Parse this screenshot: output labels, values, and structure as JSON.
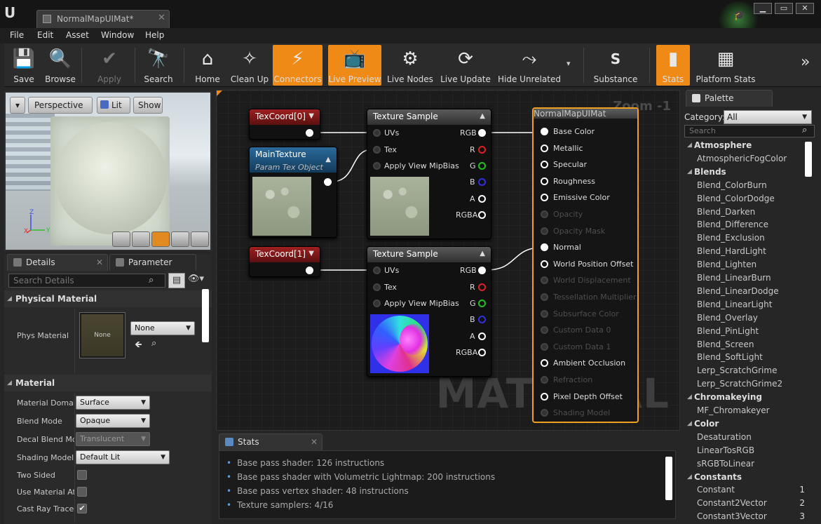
{
  "window": {
    "tab_title": "NormalMapUIMat*",
    "close_glyph": "✕",
    "buttons": [
      "▁",
      "▭",
      "✕"
    ]
  },
  "menu": [
    "File",
    "Edit",
    "Asset",
    "Window",
    "Help"
  ],
  "toolbar": {
    "items": [
      {
        "label": "Save",
        "icon": "save-icon",
        "glyph": "💾"
      },
      {
        "label": "Browse",
        "icon": "magnifier-icon",
        "glyph": "🔍"
      },
      {
        "label": "Apply",
        "icon": "apply-check-icon",
        "glyph": "✔"
      },
      {
        "label": "Search",
        "icon": "binoculars-icon",
        "glyph": "🔭"
      },
      {
        "label": "Home",
        "icon": "home-icon",
        "glyph": "⌂"
      },
      {
        "label": "Clean Up",
        "icon": "broom-icon",
        "glyph": "✧"
      },
      {
        "label": "Connectors",
        "icon": "connectors-icon",
        "glyph": "⚡"
      },
      {
        "label": "Live Preview",
        "icon": "tv-icon",
        "glyph": "📺"
      },
      {
        "label": "Live Nodes",
        "icon": "live-nodes-icon",
        "glyph": "⚙"
      },
      {
        "label": "Live Update",
        "icon": "live-update-icon",
        "glyph": "⟳"
      },
      {
        "label": "Hide Unrelated",
        "icon": "hide-unrelated-icon",
        "glyph": "⤳"
      },
      {
        "label": "Substance",
        "icon": "substance-icon",
        "glyph": "S"
      },
      {
        "label": "Stats",
        "icon": "stats-icon",
        "glyph": "▮"
      },
      {
        "label": "Platform Stats",
        "icon": "platform-stats-icon",
        "glyph": "▦"
      }
    ],
    "overflow_glyph": "»",
    "dropdown_glyph": "▾"
  },
  "viewport": {
    "view_dropdown": "▾",
    "perspective": "Perspective",
    "lit": "Lit",
    "show": "Show",
    "axis": {
      "z": "Z",
      "x": "X",
      "y": "Y"
    }
  },
  "details": {
    "tab_label": "Details",
    "tab2_label": "Parameter Defaul",
    "search_placeholder": "Search Details",
    "sections": {
      "physical": "Physical Material",
      "material": "Material"
    },
    "phys_material": {
      "label": "Phys Material",
      "thumb": "None",
      "value": "None"
    },
    "props": [
      {
        "label": "Material Domain",
        "value": "Surface"
      },
      {
        "label": "Blend Mode",
        "value": "Opaque"
      },
      {
        "label": "Decal Blend Mode",
        "value": "Translucent"
      },
      {
        "label": "Shading Model",
        "value": "Default Lit"
      },
      {
        "label": "Two Sided",
        "value": ""
      },
      {
        "label": "Use Material Attributes",
        "value": ""
      },
      {
        "label": "Cast Ray Traced Shadows",
        "value": "✔"
      }
    ]
  },
  "graph": {
    "zoom": "Zoom -1",
    "watermark": "MATERIAL",
    "nodes": {
      "texcoord0": {
        "title": "TexCoord[0]"
      },
      "texcoord1": {
        "title": "TexCoord[1]"
      },
      "maintexture": {
        "title": "MainTexture",
        "subtitle": "Param Tex Object"
      },
      "texsample1": {
        "title": "Texture Sample"
      },
      "texsample2": {
        "title": "Texture Sample"
      }
    },
    "tex_inputs": [
      "UVs",
      "Tex",
      "Apply View MipBias"
    ],
    "tex_outputs": [
      "RGB",
      "R",
      "G",
      "B",
      "A",
      "RGBA"
    ],
    "material_node": {
      "title": "NormalMapUIMat",
      "pins": [
        {
          "label": "Base Color",
          "enabled": true
        },
        {
          "label": "Metallic",
          "enabled": true
        },
        {
          "label": "Specular",
          "enabled": true
        },
        {
          "label": "Roughness",
          "enabled": true
        },
        {
          "label": "Emissive Color",
          "enabled": true
        },
        {
          "label": "Opacity",
          "enabled": false
        },
        {
          "label": "Opacity Mask",
          "enabled": false
        },
        {
          "label": "Normal",
          "enabled": true
        },
        {
          "label": "World Position Offset",
          "enabled": true
        },
        {
          "label": "World Displacement",
          "enabled": false
        },
        {
          "label": "Tessellation Multiplier",
          "enabled": false
        },
        {
          "label": "Subsurface Color",
          "enabled": false
        },
        {
          "label": "Custom Data 0",
          "enabled": false
        },
        {
          "label": "Custom Data 1",
          "enabled": false
        },
        {
          "label": "Ambient Occlusion",
          "enabled": true
        },
        {
          "label": "Refraction",
          "enabled": false
        },
        {
          "label": "Pixel Depth Offset",
          "enabled": true
        },
        {
          "label": "Shading Model",
          "enabled": false
        }
      ]
    }
  },
  "stats": {
    "tab_label": "Stats",
    "lines": [
      "Base pass shader: 126 instructions",
      "Base pass shader with Volumetric Lightmap: 200 instructions",
      "Base pass vertex shader: 48 instructions",
      "Texture samplers: 4/16"
    ]
  },
  "palette": {
    "tab_label": "Palette",
    "category_label": "Category:",
    "category_value": "All",
    "search_placeholder": "Search",
    "rows": [
      {
        "type": "cat",
        "label": "Atmosphere"
      },
      {
        "type": "item",
        "label": "AtmosphericFogColor"
      },
      {
        "type": "cat",
        "label": "Blends"
      },
      {
        "type": "item",
        "label": "Blend_ColorBurn"
      },
      {
        "type": "item",
        "label": "Blend_ColorDodge"
      },
      {
        "type": "item",
        "label": "Blend_Darken"
      },
      {
        "type": "item",
        "label": "Blend_Difference"
      },
      {
        "type": "item",
        "label": "Blend_Exclusion"
      },
      {
        "type": "item",
        "label": "Blend_HardLight"
      },
      {
        "type": "item",
        "label": "Blend_Lighten"
      },
      {
        "type": "item",
        "label": "Blend_LinearBurn"
      },
      {
        "type": "item",
        "label": "Blend_LinearDodge"
      },
      {
        "type": "item",
        "label": "Blend_LinearLight"
      },
      {
        "type": "item",
        "label": "Blend_Overlay"
      },
      {
        "type": "item",
        "label": "Blend_PinLight"
      },
      {
        "type": "item",
        "label": "Blend_Screen"
      },
      {
        "type": "item",
        "label": "Blend_SoftLight"
      },
      {
        "type": "item",
        "label": "Lerp_ScratchGrime"
      },
      {
        "type": "item",
        "label": "Lerp_ScratchGrime2"
      },
      {
        "type": "cat",
        "label": "Chromakeying"
      },
      {
        "type": "item",
        "label": "MF_Chromakeyer"
      },
      {
        "type": "cat",
        "label": "Color"
      },
      {
        "type": "item",
        "label": "Desaturation"
      },
      {
        "type": "item",
        "label": "LinearTosRGB"
      },
      {
        "type": "item",
        "label": "sRGBToLinear"
      },
      {
        "type": "cat",
        "label": "Constants"
      },
      {
        "type": "item",
        "label": "Constant",
        "key": "1"
      },
      {
        "type": "item",
        "label": "Constant2Vector",
        "key": "2"
      },
      {
        "type": "item",
        "label": "Constant3Vector",
        "key": "3"
      }
    ]
  },
  "colors": {
    "accent_orange": "#f08a17",
    "material_border": "#f0a020",
    "node_red": "#a02020",
    "node_blue": "#2a6a9a"
  }
}
